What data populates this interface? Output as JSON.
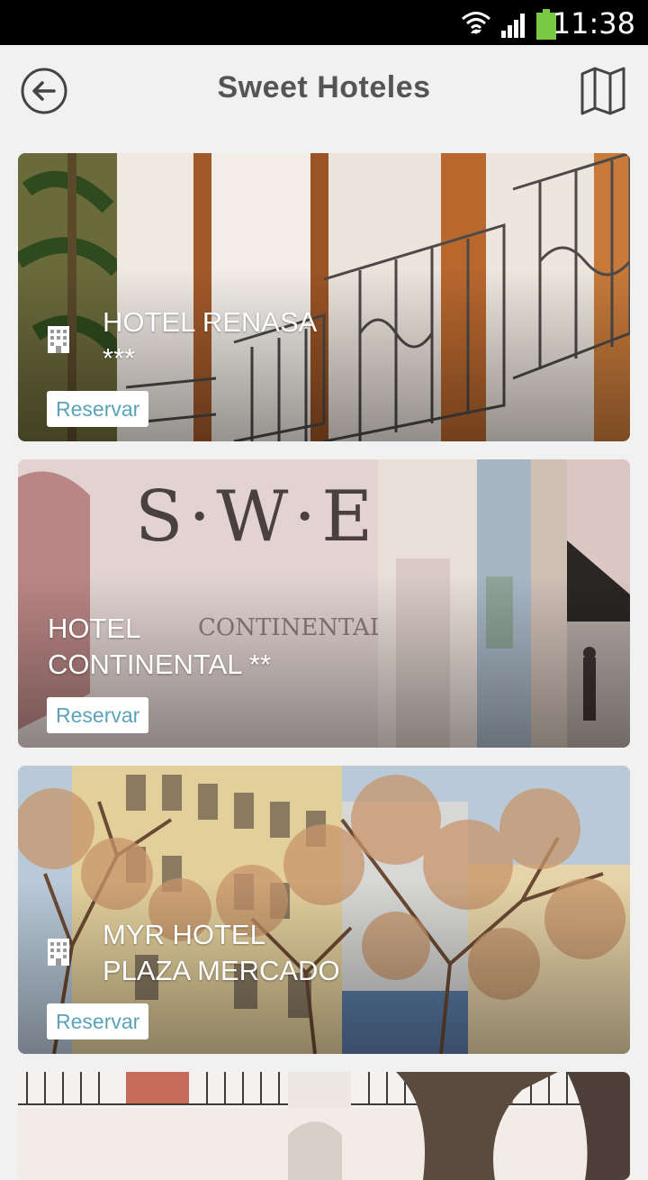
{
  "status_bar": {
    "time": "11:38",
    "icons": [
      "wifi-icon",
      "signal-icon",
      "battery-icon"
    ],
    "battery_color": "#7ac943"
  },
  "header": {
    "title": "Sweet Hoteles",
    "back_icon": "arrow-left-circle-icon",
    "map_icon": "map-icon"
  },
  "colors": {
    "background": "#f1f1f1",
    "title": "#555555",
    "reserve_text": "#5aa3b8"
  },
  "hotels": [
    {
      "name_line1": "HOTEL RENASA",
      "name_line2": "***",
      "show_icon": true,
      "reserve_label": "Reservar"
    },
    {
      "name_line1": "HOTEL",
      "name_line2": "CONTINENTAL **",
      "show_icon": false,
      "reserve_label": "Reservar"
    },
    {
      "name_line1": "MYR HOTEL",
      "name_line2": "PLAZA MERCADO",
      "show_icon": true,
      "reserve_label": "Reservar"
    }
  ]
}
